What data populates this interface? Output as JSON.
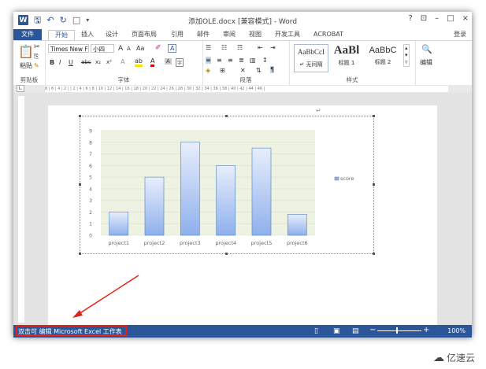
{
  "window": {
    "title": "添加OLE.docx [兼容模式] - Word",
    "controls": [
      "?",
      "⊡",
      "–",
      "□",
      "×"
    ]
  },
  "tabs": [
    {
      "label": "文件",
      "kind": "file"
    },
    {
      "label": "开始",
      "kind": "active"
    },
    {
      "label": "插入"
    },
    {
      "label": "设计"
    },
    {
      "label": "页面布局"
    },
    {
      "label": "引用"
    },
    {
      "label": "邮件"
    },
    {
      "label": "审阅"
    },
    {
      "label": "视图"
    },
    {
      "label": "开发工具"
    },
    {
      "label": "ACROBAT"
    },
    {
      "label": "登录",
      "kind": "signin"
    }
  ],
  "ribbon": {
    "clipboard": {
      "paste_label": "粘贴",
      "group_label": "剪贴板"
    },
    "font": {
      "font_name": "Times New F",
      "font_size": "小四",
      "group_label": "字体",
      "format_buttons": [
        "B",
        "I",
        "U",
        "abc",
        "x₂",
        "x²"
      ],
      "grow_shrink": [
        "A",
        "A",
        "Aa"
      ]
    },
    "paragraph": {
      "group_label": "段落"
    },
    "styles": {
      "group_label": "样式",
      "items": [
        {
          "sample": "AaBbCcI",
          "name": "↵ 无间隔"
        },
        {
          "sample": "AaBl",
          "name": "标题 1"
        },
        {
          "sample": "AaBbC",
          "name": "标题 2"
        }
      ]
    },
    "editing": {
      "label": "编辑"
    }
  },
  "ruler": {
    "ticks": "8 | 6 | 4 | 2 | | 2 | 4 | 6 | 8 | 10 | 12 | 14 | 16 | 18 | 20 | 22 | 24 | 26 | 28 | 30 | 32 | 34 | 36 | 38 | 40 | 42 | 44 | 46 |"
  },
  "chart_data": {
    "type": "bar",
    "categories": [
      "project1",
      "project2",
      "project3",
      "project4",
      "project5",
      "project6"
    ],
    "series": [
      {
        "name": "score",
        "values": [
          2,
          5,
          8,
          6,
          7.5,
          1.8
        ]
      }
    ],
    "ylim": [
      0,
      9
    ],
    "yticks": [
      0,
      1,
      2,
      3,
      4,
      5,
      6,
      7,
      8,
      9
    ],
    "grid": true,
    "legend": "right",
    "colors": {
      "bar_top": "#e8eefc",
      "bar_bottom": "#8fb0ec",
      "bar_stroke": "#4f81bd",
      "plot_bg": "#eef2e2"
    }
  },
  "statusbar": {
    "text": "双击可 编辑 Microsoft Excel 工作表",
    "zoom": "100%"
  },
  "watermark": {
    "text": "亿速云"
  },
  "accent": "#2b579a",
  "annotation_color": "#e2231a"
}
